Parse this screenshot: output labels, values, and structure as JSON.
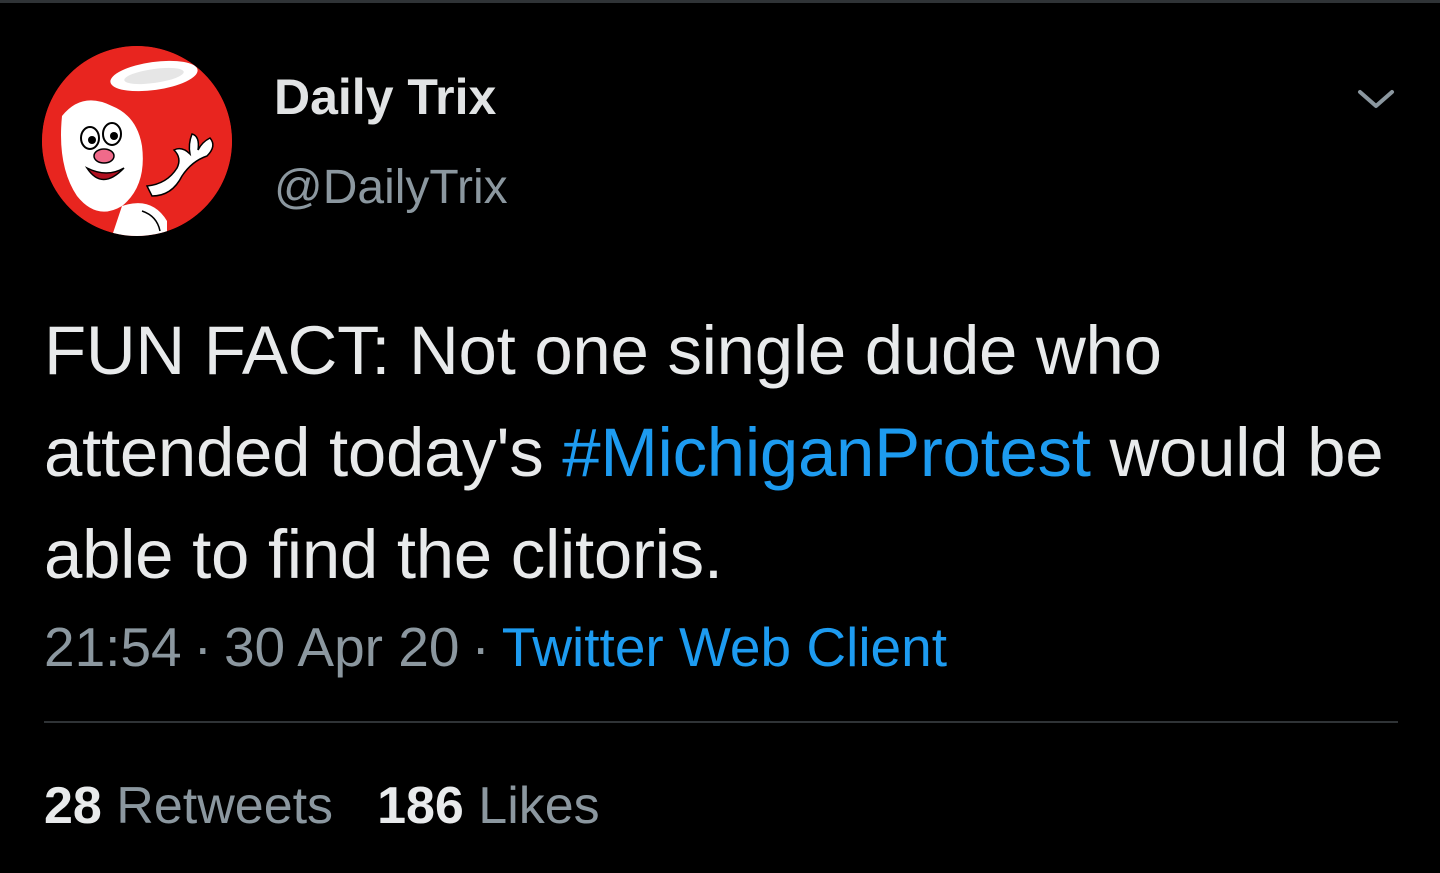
{
  "tweet": {
    "author": {
      "display_name": "Daily Trix",
      "handle": "@DailyTrix",
      "avatar_icon": "trix-rabbit-avatar",
      "avatar_bg": "#e8251f"
    },
    "menu_icon": "chevron-down-icon",
    "text_before": "FUN FACT: Not one single dude who attended today's ",
    "hashtag": "#MichiganProtest",
    "text_after": " would be able to find the clitoris.",
    "time": "21:54",
    "separator": "·",
    "date": "30 Apr 20",
    "client": "Twitter Web Client",
    "stats": {
      "retweets_count": "28",
      "retweets_label": "Retweets",
      "likes_count": "186",
      "likes_label": "Likes"
    }
  },
  "colors": {
    "background": "#000000",
    "text_primary": "#e8eaeb",
    "text_secondary": "#8b979f",
    "link": "#1d9bf0",
    "divider": "#2f3336"
  }
}
